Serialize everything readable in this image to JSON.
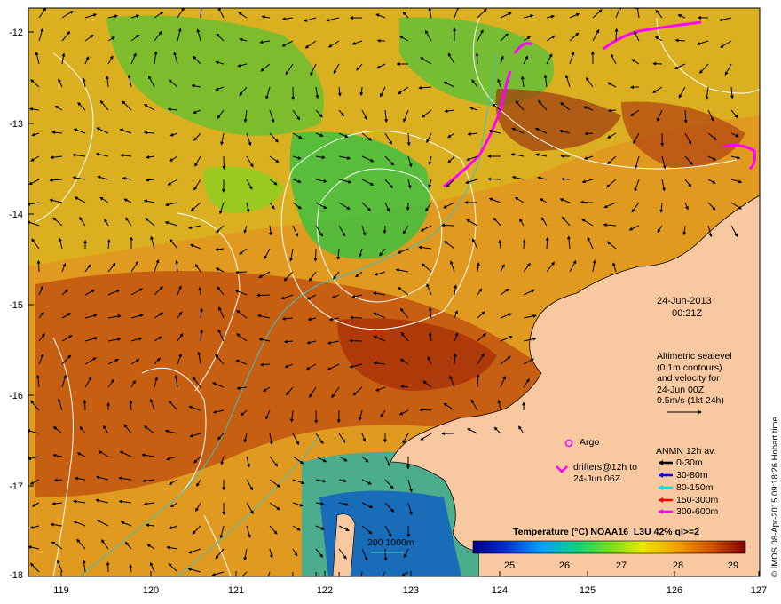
{
  "map": {
    "lat_labels": [
      "-12",
      "-13",
      "-14",
      "-15",
      "-16",
      "-17",
      "-18"
    ],
    "lon_labels": [
      "119",
      "120",
      "121",
      "122",
      "123",
      "124",
      "125",
      "126",
      "127"
    ]
  },
  "info": {
    "date": "24-Jun-2013",
    "time": "00:21Z",
    "altimetry": [
      "Altimetric sealevel",
      "(0.1m contours)",
      "and velocity for",
      "24-Jun 00Z",
      "0.5m/s (1kt 24h)"
    ]
  },
  "legend": {
    "argo": "Argo",
    "drifters": [
      "drifters@12h to",
      "24-Jun 06Z"
    ],
    "anmn_title": "ANMN 12h av.",
    "anmn_rows": [
      {
        "label": "0-30m",
        "color": "#000000"
      },
      {
        "label": "30-80m",
        "color": "#0000ff"
      },
      {
        "label": "80-150m",
        "color": "#00e0e0"
      },
      {
        "label": "150-300m",
        "color": "#ff0000"
      },
      {
        "label": "300-600m",
        "color": "#ff00ff"
      }
    ],
    "scale_bar": "200  1000m"
  },
  "colorbar": {
    "title": "Temperature (°C) NOAA16_L3U 42% ql>=2",
    "ticks": [
      "25",
      "26",
      "27",
      "28",
      "29"
    ]
  },
  "credit": "© IMOS 08-Apr-2015 09:18:26 Hobart time"
}
